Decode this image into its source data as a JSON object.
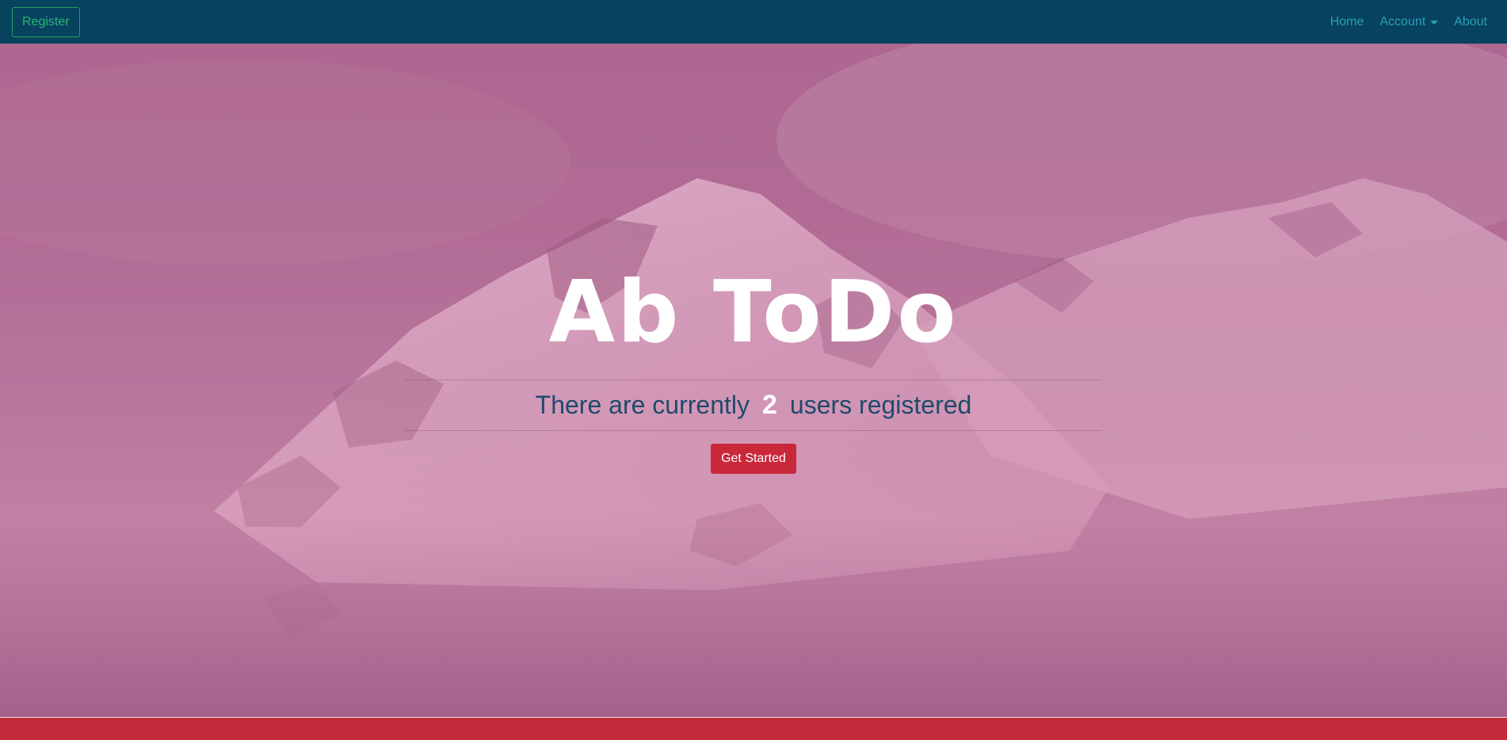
{
  "navbar": {
    "register_label": "Register",
    "links": [
      {
        "label": "Home"
      },
      {
        "label": "Account"
      },
      {
        "label": "About"
      }
    ]
  },
  "hero": {
    "title": "Ab ToDo",
    "subtitle_prefix": "There are currently",
    "user_count": "2",
    "subtitle_suffix": "users registered",
    "cta_label": "Get Started"
  },
  "colors": {
    "navbar_bg": "#07425f",
    "accent_red": "#c8283a",
    "register_green": "#2bb673",
    "nav_link": "#2a9fb8"
  },
  "icons": {
    "account_dropdown": "caret-down-icon"
  }
}
